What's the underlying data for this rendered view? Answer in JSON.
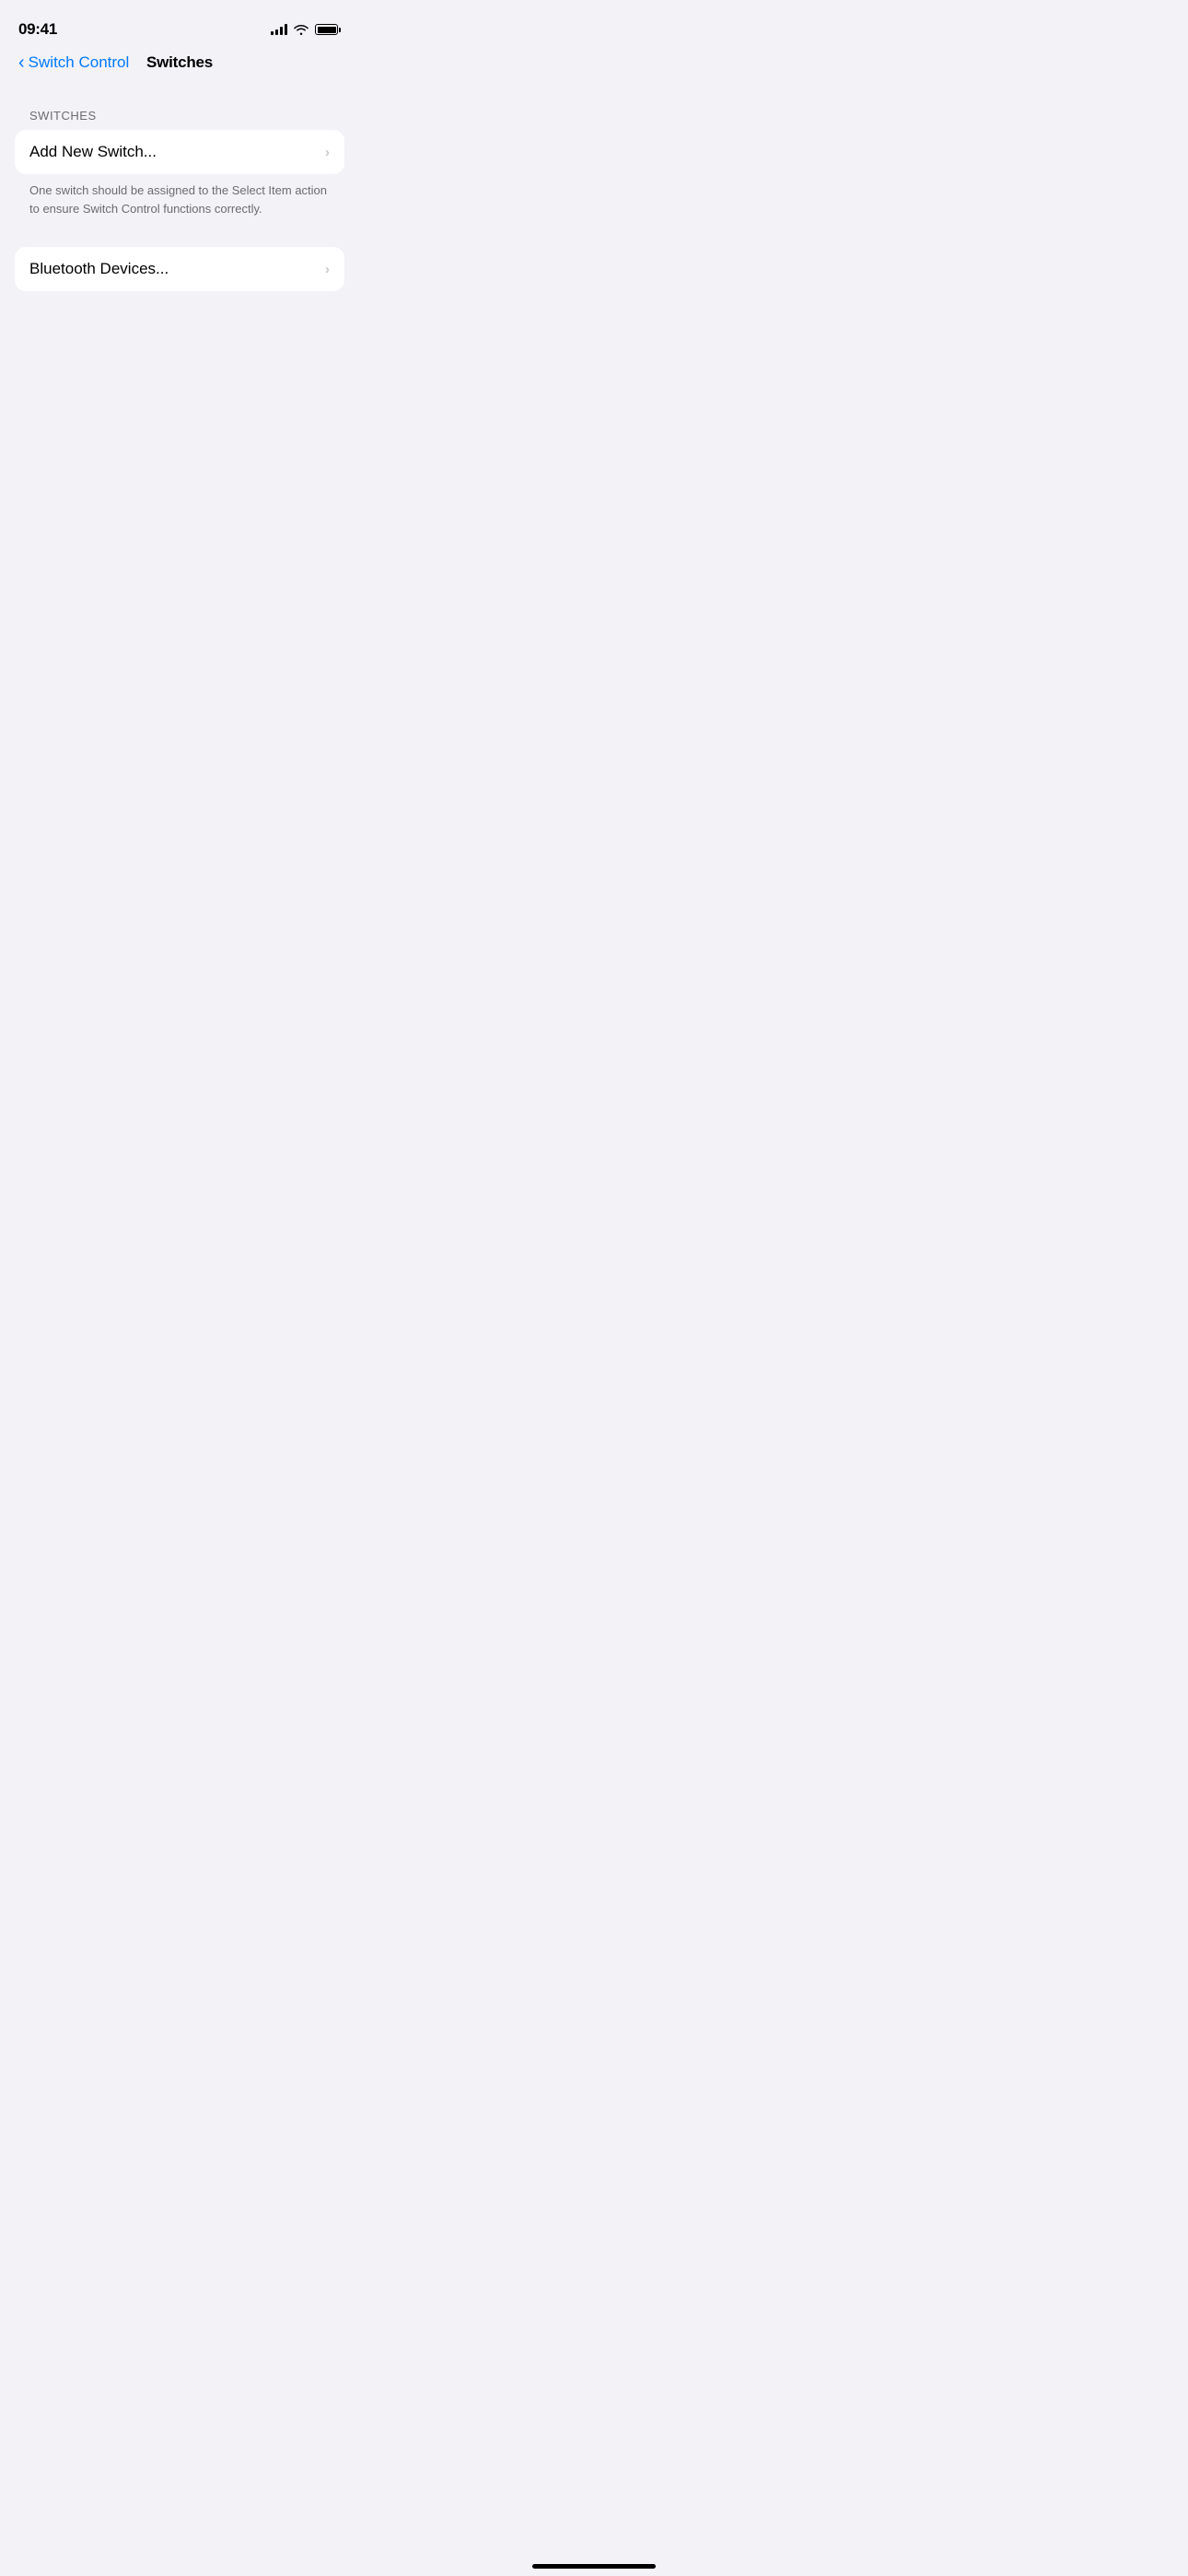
{
  "statusBar": {
    "time": "09:41"
  },
  "navigation": {
    "backLabel": "Switch Control",
    "title": "Switches"
  },
  "content": {
    "sectionLabel": "SWITCHES",
    "rows": [
      {
        "id": "add-new-switch",
        "label": "Add New Switch..."
      }
    ],
    "helperText": "One switch should be assigned to the Select Item action to ensure Switch Control functions correctly.",
    "secondaryRows": [
      {
        "id": "bluetooth-devices",
        "label": "Bluetooth Devices..."
      }
    ]
  }
}
